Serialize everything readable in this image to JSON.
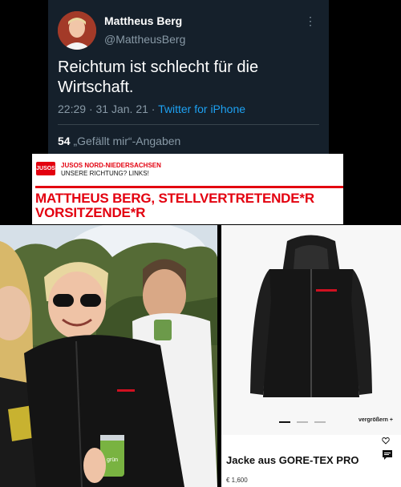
{
  "tweet": {
    "name": "Mattheus Berg",
    "handle": "@MattheusBerg",
    "menu_icon": "more-vertical-icon",
    "text": "Reichtum ist schlecht für die Wirtschaft.",
    "time": "22:29",
    "date": "31 Jan. 21",
    "source": "Twitter for iPhone",
    "likes_count": "54",
    "likes_label": "„Gefällt mir“-Angaben",
    "colors": {
      "background": "#15202b",
      "muted": "#8899a6",
      "link": "#1da1f2"
    }
  },
  "banner": {
    "logo_text": "JUSOS",
    "org": "JUSOS NORD-NIEDERSACHSEN",
    "slogan": "UNSERE RICHTUNG? LINKS!",
    "title": "MATTHEUS BERG, STELLVERTRETENDE*R VORSITZENDE*R",
    "colors": {
      "accent": "#e3000f"
    }
  },
  "photo": {
    "can_text": "grün"
  },
  "product": {
    "zoom_label": "vergrößern +",
    "name": "Jacke aus GORE-TEX PRO",
    "price": "€ 1,600",
    "icons": [
      "heart-icon",
      "chat-icon"
    ]
  }
}
